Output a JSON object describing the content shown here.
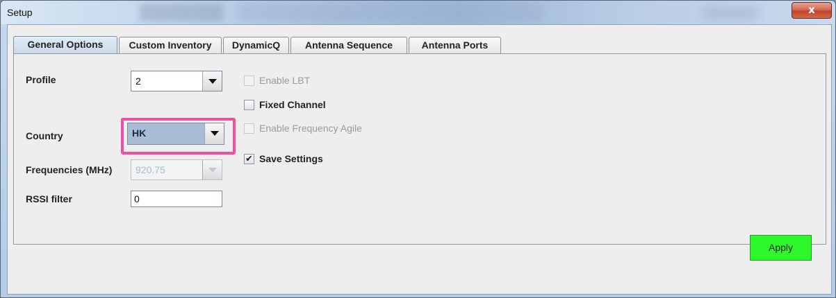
{
  "window": {
    "title": "Setup",
    "close_glyph": "x"
  },
  "tabs": [
    {
      "label": "General Options",
      "active": true
    },
    {
      "label": "Custom Inventory",
      "active": false
    },
    {
      "label": "DynamicQ",
      "active": false
    },
    {
      "label": "Antenna Sequence",
      "active": false
    },
    {
      "label": "Antenna Ports",
      "active": false
    }
  ],
  "form": {
    "profile": {
      "label": "Profile",
      "value": "2"
    },
    "country": {
      "label": "Country",
      "value": "HK"
    },
    "frequencies": {
      "label": "Frequencies (MHz)",
      "value": "920.75",
      "enabled": false
    },
    "rssi": {
      "label": "RSSI filter",
      "value": "0"
    }
  },
  "options": {
    "enable_lbt": {
      "label": "Enable LBT",
      "checked": false,
      "enabled": false
    },
    "fixed_channel": {
      "label": "Fixed Channel",
      "checked": false,
      "enabled": true
    },
    "enable_freq_agile": {
      "label": "Enable Frequency Agile",
      "checked": false,
      "enabled": false
    },
    "save_settings": {
      "label": "Save Settings",
      "checked": true,
      "enabled": true,
      "check_glyph": "✔"
    }
  },
  "footer": {
    "apply_label": "Apply"
  },
  "colors": {
    "apply_bg": "#2cf82c",
    "highlight_border": "#ee4f9e",
    "close_button": "#c1422a"
  },
  "icons": {
    "dropdown": "chevron-down-icon",
    "close": "close-icon",
    "check": "checkmark-icon"
  }
}
